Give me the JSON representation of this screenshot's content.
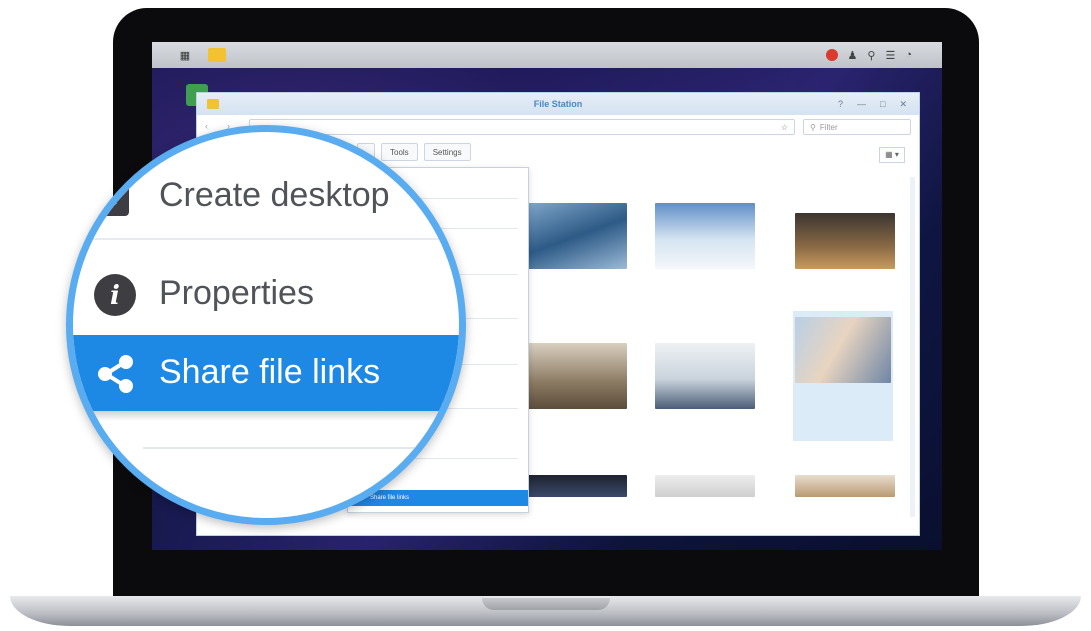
{
  "window": {
    "title": "File Station"
  },
  "taskbar": {
    "icons": [
      "grid-icon",
      "folder-icon",
      "notification-icon",
      "user-icon",
      "search-icon",
      "options-icon",
      "widgets-icon"
    ]
  },
  "toolbar": {
    "buttons": [
      "",
      "Tools",
      "Settings"
    ]
  },
  "search": {
    "placeholder": "Filter"
  },
  "context_menu": {
    "selected_label": "Share file links"
  },
  "magnifier": {
    "items": [
      {
        "label": "Create desktop",
        "icon": "shortcut-icon"
      },
      {
        "label": "Properties",
        "icon": "info-icon"
      },
      {
        "label": "Share file links",
        "icon": "share-icon",
        "highlighted": true
      }
    ]
  },
  "colors": {
    "accent": "#1e88e5",
    "ring": "#5aacf0"
  }
}
